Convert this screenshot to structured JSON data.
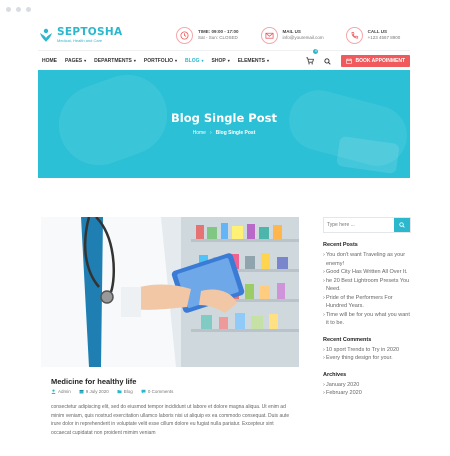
{
  "brand": {
    "name": "SEPTOSHA",
    "tagline": "Medical, Health and Care",
    "accent": "#2bb7cc",
    "cta_color": "#f05a5d"
  },
  "contact": [
    {
      "title": "TIME: 09:00 - 17:00",
      "sub": "Sat - Sun: CLOSED",
      "icon": "clock-icon"
    },
    {
      "title": "MAIL US",
      "sub": "info@youremail.com",
      "icon": "mail-icon"
    },
    {
      "title": "CALL US",
      "sub": "+123 4567 8900",
      "icon": "phone-icon"
    }
  ],
  "nav": {
    "items": [
      "HOME",
      "PAGES",
      "DEPARTMENTS",
      "PORTFOLIO",
      "BLOG",
      "SHOP",
      "ELEMENTS"
    ],
    "active": "BLOG",
    "cart_count": "0",
    "cta": "BOOK APPOINMENT"
  },
  "hero": {
    "title": "Blog Single Post",
    "crumb_home": "Home",
    "crumb_sep": "›",
    "crumb_current": "Blog Single Post"
  },
  "post": {
    "title": "Medicine for healthy life",
    "author": "Admin",
    "date": "9 July 2020",
    "category": "Blog",
    "comments": "0 Comments",
    "excerpt": "consectetur adipiscing elit, sed do eiusmod tempor incididunt ut labore et dolore magna aliqua. Ut enim ad minim veniam, quis nostrud exercitation ullamco laboris nisi ut aliquip ex ea commodo consequat. Duis aute irure dolor in reprehenderit in voluptate velit esse cillum dolore eu fugiat nulla pariatur. Excepteur sint occaecat cupidatat non proident mimim veniam"
  },
  "sidebar": {
    "search_placeholder": "Type here ...",
    "recent_posts_title": "Recent Posts",
    "recent_posts": [
      "You don't want Traveling as your enemy!",
      "Good City Has Written All Over It.",
      "he 20 Best Lightroom Presets You Need.",
      "Pride of the Performers For Hundred Years.",
      "Time will be for you what you want it to be."
    ],
    "recent_comments_title": "Recent Comments",
    "recent_comments": [
      "10 sport Trends to Try in 2020",
      "Every thing design for your."
    ],
    "archives_title": "Archives",
    "archives": [
      "January 2020",
      "February 2020"
    ]
  }
}
